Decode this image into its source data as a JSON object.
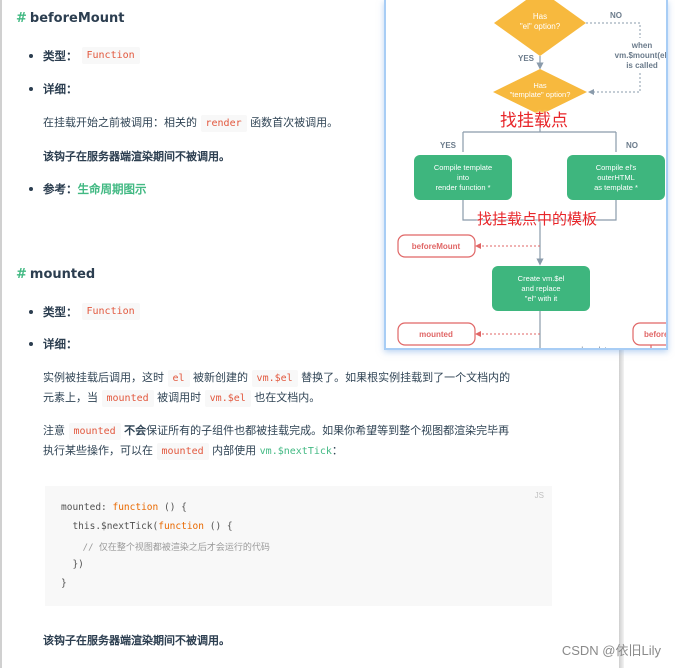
{
  "before_mount": {
    "hash": "#",
    "title": "beforeMount",
    "type_label": "类型：",
    "type_value": "Function",
    "detail_label": "详细：",
    "detail_text_pre": "在挂载开始之前被调用：相关的",
    "detail_code": "render",
    "detail_text_post": "函数首次被调用。",
    "ssr_note": "该钩子在服务器端渲染期间不被调用。",
    "ref_label": "参考：",
    "ref_link": "生命周期图示"
  },
  "mounted": {
    "hash": "#",
    "title": "mounted",
    "type_label": "类型：",
    "type_value": "Function",
    "detail_label": "详细：",
    "p1": {
      "t1": "实例被挂载后调用，这时",
      "c1": "el",
      "t2": "被新创建的",
      "c2": "vm.$el",
      "t3": "替换了。如果根实例挂载到了一个文档内的",
      "t4": "元素上，当",
      "c3": "mounted",
      "t5": "被调用时",
      "c4": "vm.$el",
      "t6": "也在文档内。"
    },
    "p2": {
      "t1": "注意",
      "c1": "mounted",
      "b1": "不会",
      "t2": "保证所有的子组件也都被挂载完成。如果你希望等到整个视图都渲染完毕再",
      "t3": "执行某些操作，可以在",
      "c2": "mounted",
      "t4": "内部使用",
      "link": "vm.$nextTick",
      "t5": "："
    },
    "code": {
      "lang": "JS",
      "line1_a": "mounted: ",
      "line1_kw": "function",
      "line1_b": " () {",
      "line2_a": "  this.$nextTick(",
      "line2_kw": "function",
      "line2_b": " () {",
      "line3": "    // 仅在整个视图都被渲染之后才会运行的代码",
      "line4": "  })",
      "line5": "}"
    },
    "ssr_note": "该钩子在服务器端渲染期间不被调用。"
  },
  "diagram": {
    "has_el": [
      "Has",
      "\"el\" option?"
    ],
    "no": "NO",
    "yes": "YES",
    "when_mount": [
      "when",
      "vm.$mount(el)",
      "is called"
    ],
    "has_template": [
      "Has",
      "\"template\" option?"
    ],
    "compile_template": [
      "Compile template",
      "into",
      "render function *"
    ],
    "compile_el": [
      "Compile el's",
      "outerHTML",
      "as template *"
    ],
    "before_mount": "beforeMount",
    "create_el": [
      "Create vm.$el",
      "and replace",
      "\"el\" with it"
    ],
    "mounted": "mounted",
    "before_update": "before",
    "when_data": "when data",
    "annot_find_mount": "找挂载点",
    "annot_find_template": "找挂载点中的模板",
    "colors": {
      "decision": "#f7b93e",
      "process": "#3eb67e",
      "hook": "#e06666",
      "line": "#8a9bab",
      "annot": "#e8262a"
    }
  },
  "watermark": "CSDN @依旧Lily"
}
